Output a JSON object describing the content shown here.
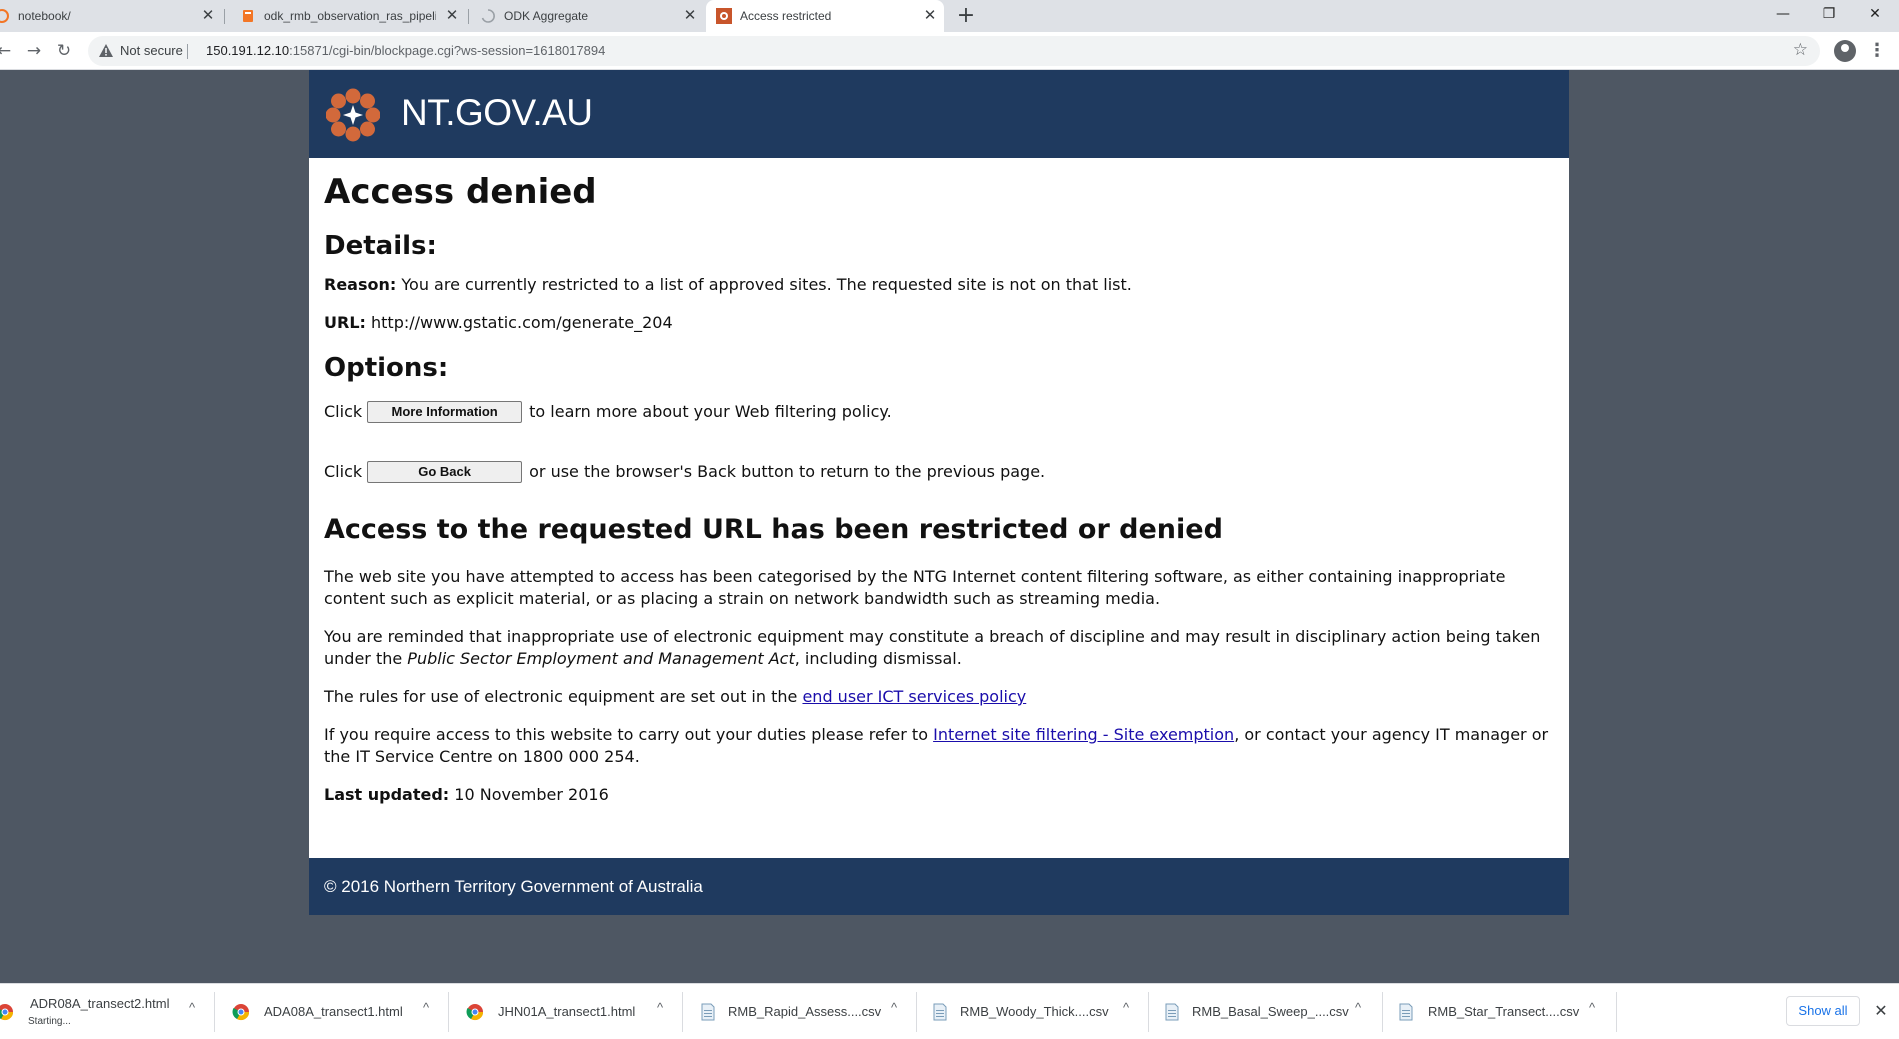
{
  "browser": {
    "tabs": [
      {
        "title": "notebook/"
      },
      {
        "title": "odk_rmb_observation_ras_pipeline"
      },
      {
        "title": "ODK Aggregate"
      },
      {
        "title": "Access restricted"
      }
    ],
    "security_label": "Not secure",
    "url_host": "150.191.12.10",
    "url_path": ":15871/cgi-bin/blockpage.cgi?ws-session=1618017894"
  },
  "page": {
    "site_name": "NT.GOV.AU",
    "heading": "Access denied",
    "details_heading": "Details:",
    "reason_label": "Reason:",
    "reason_text": "You are currently restricted to a list of approved sites. The requested site is not on that list.",
    "url_label": "URL:",
    "url_text": "http://www.gstatic.com/generate_204",
    "options_heading": "Options:",
    "option1": {
      "prefix": "Click",
      "button": "More Information",
      "suffix": "to learn more about your Web filtering policy."
    },
    "option2": {
      "prefix": "Click",
      "button": "Go Back",
      "suffix": "or use the browser's Back button to return to the previous page."
    },
    "restricted_heading": "Access to the requested URL has been restricted or denied",
    "para1": "The web site you have attempted to access has been categorised by the NTG Internet content filtering software, as either containing inappropriate content such as explicit material, or as placing a strain on network bandwidth such as streaming media.",
    "para2_start": "You are reminded that inappropriate use of electronic equipment may constitute a breach of discipline and may result in disciplinary action being taken under the",
    "para2_act": "Public Sector Employment and Management Act",
    "para2_end": ", including dismissal.",
    "para3_start": "The rules for use of electronic equipment are set out in the",
    "para3_link": "end user ICT services policy",
    "para4_start": "If you require access to this website to carry out your duties please refer to",
    "para4_link": "Internet site filtering - Site exemption",
    "para4_end": ", or contact your agency IT manager or the IT Service Centre on 1800 000 254.",
    "updated_label": "Last updated:",
    "updated_value": "10 November 2016",
    "footer": "© 2016 Northern Territory Government of Australia"
  },
  "downloads": {
    "items": [
      {
        "name": "ADR08A_transect2.html",
        "status": "Starting...",
        "icon": "chrome-icon"
      },
      {
        "name": "ADA08A_transect1.html",
        "icon": "chrome-icon"
      },
      {
        "name": "JHN01A_transect1.html",
        "icon": "chrome-icon"
      },
      {
        "name": "RMB_Rapid_Assess....csv",
        "icon": "csv-file-icon"
      },
      {
        "name": "RMB_Woody_Thick....csv",
        "icon": "csv-file-icon"
      },
      {
        "name": "RMB_Basal_Sweep_....csv",
        "icon": "csv-file-icon"
      },
      {
        "name": "RMB_Star_Transect....csv",
        "icon": "csv-file-icon"
      }
    ],
    "show_all": "Show all"
  }
}
